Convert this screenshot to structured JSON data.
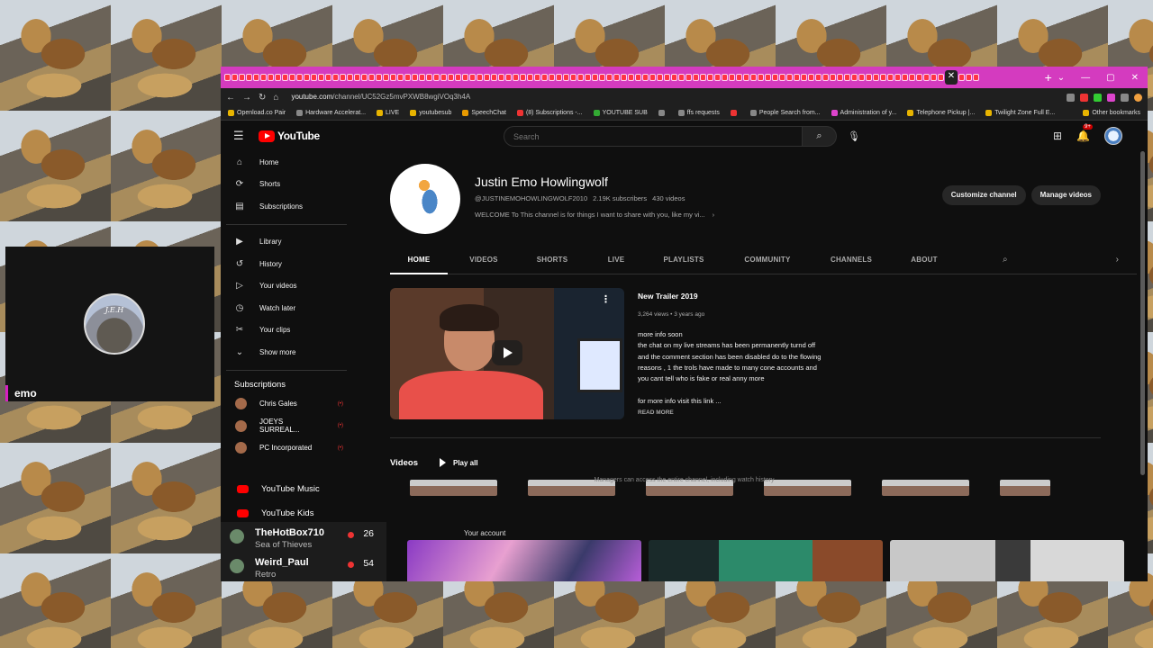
{
  "overlay": {
    "cam_avatar_text": "J.E.H",
    "cam_name": "emo"
  },
  "browser": {
    "new_tab": "+",
    "controls": [
      "⌄",
      "—",
      "▢",
      "✕"
    ],
    "url_domain": "youtube.com",
    "url_path": "/channel/UC52Gz5mvPXWB8wgiVOq3h4A",
    "bookmarks": [
      "Openload.co Pair",
      "Hardware Accelerat...",
      "LIVE",
      "youtubesub",
      "SpeechChat",
      "(8) Subscriptions -...",
      "YOUTUBE SUB",
      "",
      "ffs requests",
      "",
      "People Search from...",
      "Administration of y...",
      "Telephone Pickup |...",
      "Twilight Zone Full E..."
    ],
    "other_bookmarks": "Other bookmarks"
  },
  "yt": {
    "logo_text": "YouTube",
    "search_placeholder": "Search",
    "notification_badge": "9+",
    "nav": [
      {
        "label": "Home",
        "icon": "home-icon",
        "glyph": "⌂"
      },
      {
        "label": "Shorts",
        "icon": "shorts-icon",
        "glyph": "⟳"
      },
      {
        "label": "Subscriptions",
        "icon": "subscriptions-icon",
        "glyph": "▤"
      },
      {
        "label": "Library",
        "icon": "library-icon",
        "glyph": "▶"
      },
      {
        "label": "History",
        "icon": "history-icon",
        "glyph": "↺"
      },
      {
        "label": "Your videos",
        "icon": "your-videos-icon",
        "glyph": "▷"
      },
      {
        "label": "Watch later",
        "icon": "watch-later-icon",
        "glyph": "◷"
      },
      {
        "label": "Your clips",
        "icon": "clips-icon",
        "glyph": "✂"
      },
      {
        "label": "Show more",
        "icon": "chevron-down-icon",
        "glyph": "⌄"
      }
    ],
    "subscriptions_heading": "Subscriptions",
    "subscriptions": [
      {
        "name": "Chris Gales",
        "live": "(•)"
      },
      {
        "name": "JOEYS SURREAL...",
        "live": "(•)"
      },
      {
        "name": "PC Incorporated",
        "live": "(•)"
      }
    ],
    "more_items": [
      "YouTube Music",
      "YouTube Kids"
    ]
  },
  "channel": {
    "name": "Justin Emo Howlingwolf",
    "handle": "@JUSTINEMOHOWLINGWOLF2010",
    "subscribers": "2.19K subscribers",
    "videos_count": "430 videos",
    "description": "WELCOME To This channel is for things I want to share with you, like my vi...",
    "customize_btn": "Customize channel",
    "manage_btn": "Manage videos",
    "tabs": [
      "HOME",
      "VIDEOS",
      "SHORTS",
      "LIVE",
      "PLAYLISTS",
      "COMMUNITY",
      "CHANNELS",
      "ABOUT"
    ]
  },
  "featured": {
    "title": "New Trailer 2019",
    "meta": "3,264 views • 3 years ago",
    "description": "more info soon\nthe chat on my live streams has been permanently  turnd off\nand the comment section has been disabled  do to the flowing\nreasons  , 1 the trols have made to many cone accounts  and\nyou cant tell who is fake or real  anny more\n\nfor more info visit this link ...",
    "read_more": "READ MORE"
  },
  "videos_section": {
    "title": "Videos",
    "play_all": "Play all",
    "manager_note": "Managers can access the entire channel, including watch history",
    "your_account": "Your account"
  },
  "chat": [
    {
      "name": "TheHotBox710",
      "sub": "Sea of Thieves",
      "count": "26"
    },
    {
      "name": "Weird_Paul",
      "sub": "Retro",
      "count": "54"
    }
  ]
}
